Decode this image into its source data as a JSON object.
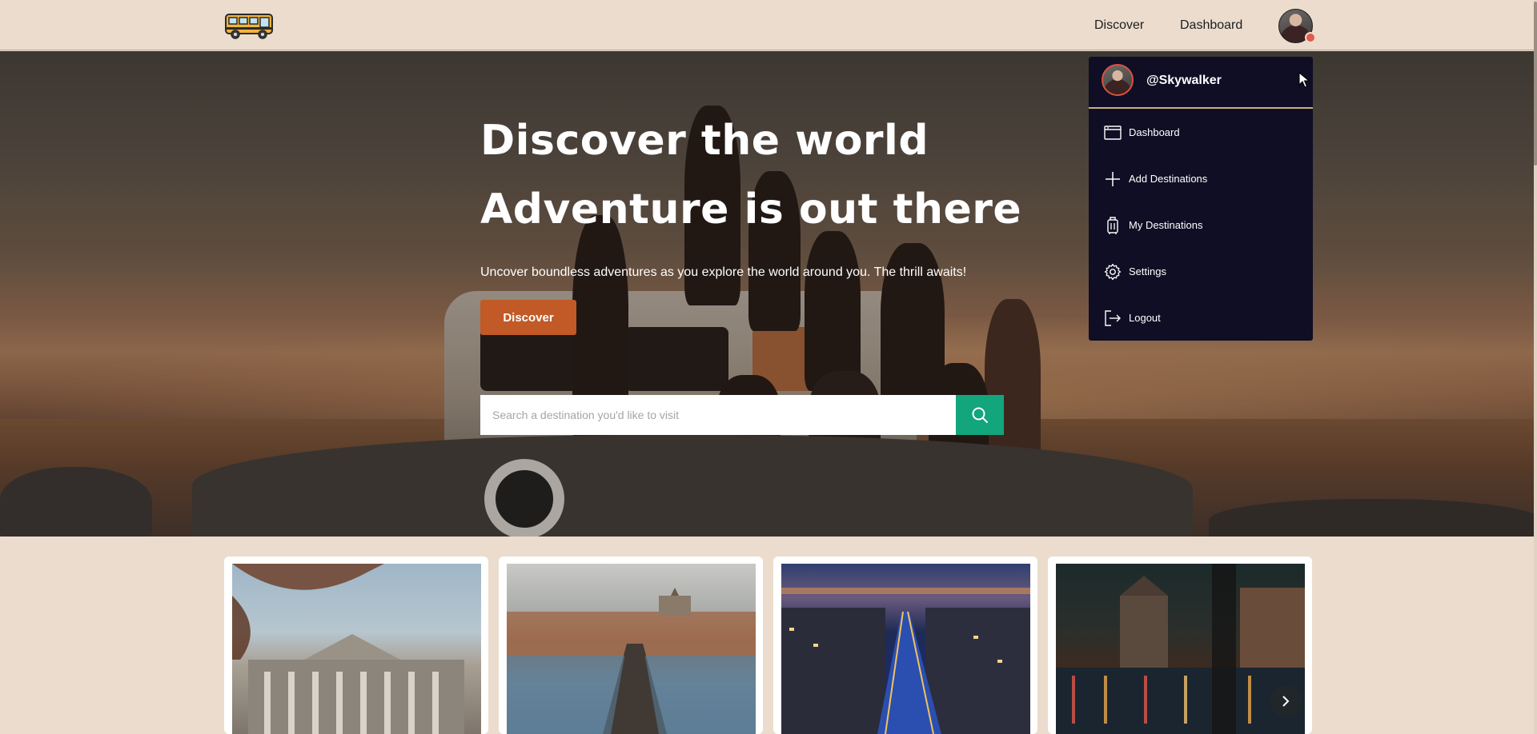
{
  "navbar": {
    "logo_icon": "school-bus-icon",
    "links": [
      {
        "label": "Discover"
      },
      {
        "label": "Dashboard"
      }
    ],
    "avatar_icon": "user-avatar"
  },
  "hero": {
    "title_line_1": "Discover the world",
    "title_line_2": "Adventure is out there",
    "subtitle": "Uncover boundless adventures as you explore the world around you. The thrill awaits!",
    "cta_label": "Discover",
    "search": {
      "value": "",
      "placeholder": "Search a destination you'd like to visit",
      "button_icon": "search-icon"
    }
  },
  "user_menu": {
    "username": "@Skywalker",
    "items": [
      {
        "label": "Dashboard",
        "icon": "dashboard-window-icon"
      },
      {
        "label": "Add Destinations",
        "icon": "plus-icon"
      },
      {
        "label": "My Destinations",
        "icon": "luggage-icon"
      },
      {
        "label": "Settings",
        "icon": "gear-icon"
      },
      {
        "label": "Logout",
        "icon": "logout-icon"
      }
    ]
  },
  "destinations": {
    "cards": [
      {
        "image": "reichstag-building-photo"
      },
      {
        "image": "prague-charles-bridge-photo"
      },
      {
        "image": "dublin-river-night-photo"
      },
      {
        "image": "amsterdam-canal-night-photo"
      }
    ],
    "next_icon": "chevron-right-icon"
  },
  "colors": {
    "page_bg": "#ebdccd",
    "accent_orange": "#c15a26",
    "search_green": "#13a57c",
    "menu_bg": "#0f0e24",
    "menu_divider": "#c9b07a"
  }
}
